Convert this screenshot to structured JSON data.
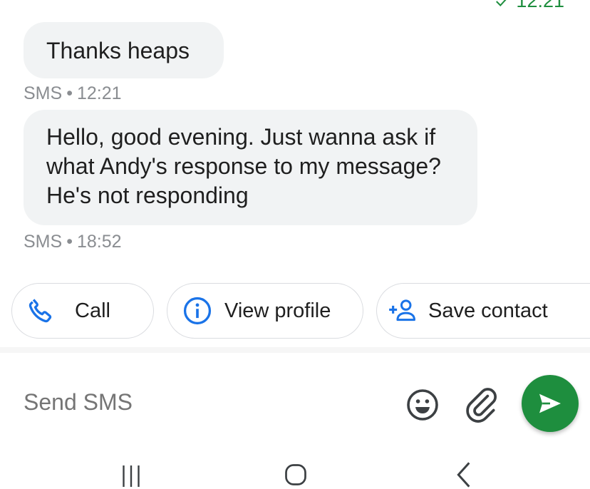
{
  "previous_message": {
    "time": "12:21",
    "status_icon": "check-icon"
  },
  "messages": [
    {
      "text": "Thanks heaps",
      "channel": "SMS",
      "separator": "•",
      "time": "12:21"
    },
    {
      "text": "Hello, good evening. Just wanna ask if what Andy's response to my message? He's not responding",
      "channel": "SMS",
      "separator": "•",
      "time": "18:52"
    }
  ],
  "actions": {
    "call": {
      "label": "Call",
      "icon": "phone-icon"
    },
    "view_profile": {
      "label": "View profile",
      "icon": "info-icon"
    },
    "save_contact": {
      "label": "Save contact",
      "icon": "add-contact-icon"
    }
  },
  "compose": {
    "placeholder": "Send SMS",
    "value": "",
    "emoji_icon": "emoji-icon",
    "attach_icon": "paperclip-icon",
    "send_icon": "send-icon"
  },
  "colors": {
    "accent_green": "#1e8e3e",
    "icon_blue": "#1a73e8",
    "bubble_bg": "#f1f3f4",
    "meta_text": "#8a8d91"
  },
  "navbar": {
    "recents_icon": "recents-icon",
    "home_icon": "home-icon",
    "back_icon": "back-icon"
  }
}
